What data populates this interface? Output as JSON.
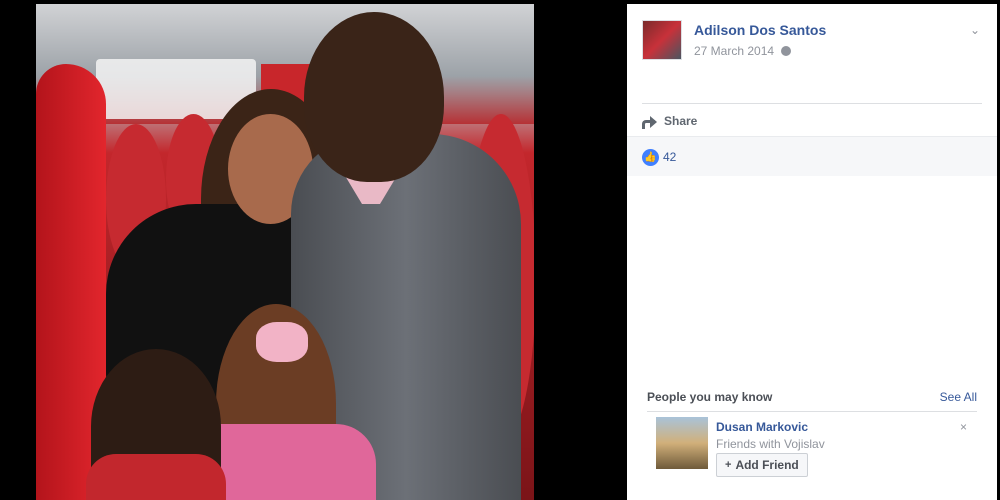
{
  "post": {
    "author": "Adilson Dos Santos",
    "date": "27 March 2014",
    "privacy_icon": "globe-icon",
    "options_icon": "chevron-down-icon"
  },
  "actions": {
    "share_label": "Share"
  },
  "reactions": {
    "like_count": "42",
    "like_icon": "thumbs-up-icon",
    "accent": "#4080ff"
  },
  "people_you_may_know": {
    "title": "People you may know",
    "see_all": "See All",
    "suggestion": {
      "name": "Dusan Markovic",
      "subtitle": "Friends with Vojislav",
      "add_friend_label": "Add Friend",
      "add_icon": "+",
      "dismiss_icon": "×"
    }
  },
  "colors": {
    "link": "#365899",
    "muted": "#90949c"
  }
}
